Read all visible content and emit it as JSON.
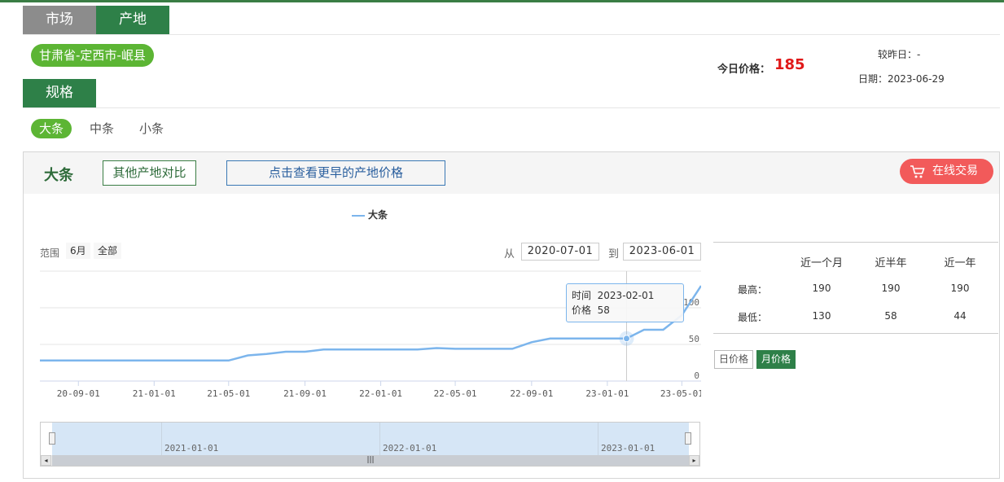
{
  "tabs": [
    {
      "label": "市场"
    },
    {
      "label": "产地"
    }
  ],
  "origin": {
    "label": "甘肃省-定西市-岷县"
  },
  "spec_title": "规格",
  "spec_options": [
    {
      "label": "大条"
    },
    {
      "label": "中条"
    },
    {
      "label": "小条"
    }
  ],
  "panel": {
    "title": "大条",
    "compare_button": "其他产地对比",
    "earlier_button": "点击查看更早的产地价格",
    "trade_button": "在线交易"
  },
  "chart": {
    "legend": "大条",
    "range_label": "范围",
    "range_buttons": [
      "6月",
      "全部"
    ],
    "from_label": "从",
    "to_label": "到",
    "from_date": "2020-07-01",
    "to_date": "2023-06-01",
    "y_ticks": [
      "0",
      "50",
      "100"
    ],
    "x_ticks": [
      "20-09-01",
      "21-01-01",
      "21-05-01",
      "21-09-01",
      "22-01-01",
      "22-05-01",
      "22-09-01",
      "23-01-01",
      "23-05-01"
    ],
    "navigator_ticks": [
      "2021-01-01",
      "2022-01-01",
      "2023-01-01"
    ],
    "tooltip": {
      "time_label": "时间",
      "time_value": "2023-02-01",
      "price_label": "价格",
      "price_value": "58"
    },
    "series_color": "#7cb5ec"
  },
  "chart_data": {
    "type": "line",
    "series": [
      {
        "name": "大条",
        "x": [
          "2020-07-01",
          "2020-08-01",
          "2020-09-01",
          "2020-10-01",
          "2020-11-01",
          "2020-12-01",
          "2021-01-01",
          "2021-02-01",
          "2021-03-01",
          "2021-04-01",
          "2021-05-01",
          "2021-06-01",
          "2021-07-01",
          "2021-08-01",
          "2021-09-01",
          "2021-10-01",
          "2021-11-01",
          "2021-12-01",
          "2022-01-01",
          "2022-02-01",
          "2022-03-01",
          "2022-04-01",
          "2022-05-01",
          "2022-06-01",
          "2022-07-01",
          "2022-08-01",
          "2022-09-01",
          "2022-10-01",
          "2022-11-01",
          "2022-12-01",
          "2023-01-01",
          "2023-02-01",
          "2023-03-01",
          "2023-04-01",
          "2023-05-01",
          "2023-06-01"
        ],
        "values": [
          28,
          28,
          28,
          28,
          28,
          28,
          28,
          28,
          28,
          28,
          28,
          35,
          37,
          40,
          40,
          43,
          43,
          43,
          43,
          43,
          43,
          45,
          44,
          44,
          44,
          44,
          53,
          58,
          58,
          58,
          58,
          58,
          70,
          70,
          90,
          130
        ]
      }
    ],
    "xlabel": "",
    "ylabel": "",
    "ylim": [
      0,
      150
    ],
    "x_range": [
      "2020-07-01",
      "2023-06-01"
    ]
  },
  "price_info": {
    "today_label": "今日价格：",
    "today_value": "185",
    "prev_label": "较昨日：-",
    "date_label": "日期：2023-06-29",
    "columns": [
      "近一个月",
      "近半年",
      "近一年"
    ],
    "rows": [
      {
        "label": "最高：",
        "values": [
          "190",
          "190",
          "190"
        ]
      },
      {
        "label": "最低：",
        "values": [
          "130",
          "58",
          "44"
        ]
      }
    ]
  },
  "period_toggle": {
    "day": "日价格",
    "month": "月价格"
  }
}
